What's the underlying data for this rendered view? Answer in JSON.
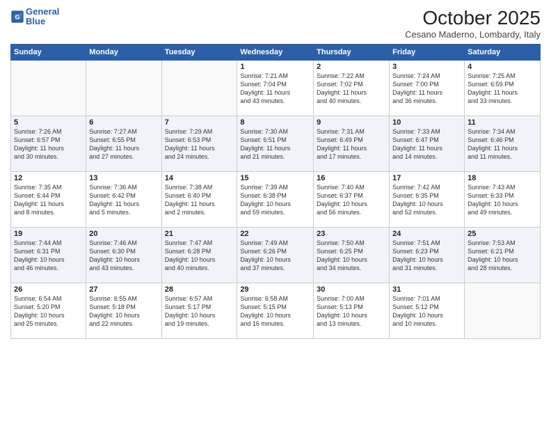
{
  "header": {
    "logo_line1": "General",
    "logo_line2": "Blue",
    "title": "October 2025",
    "location": "Cesano Maderno, Lombardy, Italy"
  },
  "weekdays": [
    "Sunday",
    "Monday",
    "Tuesday",
    "Wednesday",
    "Thursday",
    "Friday",
    "Saturday"
  ],
  "weeks": [
    [
      {
        "day": "",
        "info": ""
      },
      {
        "day": "",
        "info": ""
      },
      {
        "day": "",
        "info": ""
      },
      {
        "day": "1",
        "info": "Sunrise: 7:21 AM\nSunset: 7:04 PM\nDaylight: 11 hours\nand 43 minutes."
      },
      {
        "day": "2",
        "info": "Sunrise: 7:22 AM\nSunset: 7:02 PM\nDaylight: 11 hours\nand 40 minutes."
      },
      {
        "day": "3",
        "info": "Sunrise: 7:24 AM\nSunset: 7:00 PM\nDaylight: 11 hours\nand 36 minutes."
      },
      {
        "day": "4",
        "info": "Sunrise: 7:25 AM\nSunset: 6:59 PM\nDaylight: 11 hours\nand 33 minutes."
      }
    ],
    [
      {
        "day": "5",
        "info": "Sunrise: 7:26 AM\nSunset: 6:57 PM\nDaylight: 11 hours\nand 30 minutes."
      },
      {
        "day": "6",
        "info": "Sunrise: 7:27 AM\nSunset: 6:55 PM\nDaylight: 11 hours\nand 27 minutes."
      },
      {
        "day": "7",
        "info": "Sunrise: 7:29 AM\nSunset: 6:53 PM\nDaylight: 11 hours\nand 24 minutes."
      },
      {
        "day": "8",
        "info": "Sunrise: 7:30 AM\nSunset: 6:51 PM\nDaylight: 11 hours\nand 21 minutes."
      },
      {
        "day": "9",
        "info": "Sunrise: 7:31 AM\nSunset: 6:49 PM\nDaylight: 11 hours\nand 17 minutes."
      },
      {
        "day": "10",
        "info": "Sunrise: 7:33 AM\nSunset: 6:47 PM\nDaylight: 11 hours\nand 14 minutes."
      },
      {
        "day": "11",
        "info": "Sunrise: 7:34 AM\nSunset: 6:46 PM\nDaylight: 11 hours\nand 11 minutes."
      }
    ],
    [
      {
        "day": "12",
        "info": "Sunrise: 7:35 AM\nSunset: 6:44 PM\nDaylight: 11 hours\nand 8 minutes."
      },
      {
        "day": "13",
        "info": "Sunrise: 7:36 AM\nSunset: 6:42 PM\nDaylight: 11 hours\nand 5 minutes."
      },
      {
        "day": "14",
        "info": "Sunrise: 7:38 AM\nSunset: 6:40 PM\nDaylight: 11 hours\nand 2 minutes."
      },
      {
        "day": "15",
        "info": "Sunrise: 7:39 AM\nSunset: 6:38 PM\nDaylight: 10 hours\nand 59 minutes."
      },
      {
        "day": "16",
        "info": "Sunrise: 7:40 AM\nSunset: 6:37 PM\nDaylight: 10 hours\nand 56 minutes."
      },
      {
        "day": "17",
        "info": "Sunrise: 7:42 AM\nSunset: 6:35 PM\nDaylight: 10 hours\nand 52 minutes."
      },
      {
        "day": "18",
        "info": "Sunrise: 7:43 AM\nSunset: 6:33 PM\nDaylight: 10 hours\nand 49 minutes."
      }
    ],
    [
      {
        "day": "19",
        "info": "Sunrise: 7:44 AM\nSunset: 6:31 PM\nDaylight: 10 hours\nand 46 minutes."
      },
      {
        "day": "20",
        "info": "Sunrise: 7:46 AM\nSunset: 6:30 PM\nDaylight: 10 hours\nand 43 minutes."
      },
      {
        "day": "21",
        "info": "Sunrise: 7:47 AM\nSunset: 6:28 PM\nDaylight: 10 hours\nand 40 minutes."
      },
      {
        "day": "22",
        "info": "Sunrise: 7:49 AM\nSunset: 6:26 PM\nDaylight: 10 hours\nand 37 minutes."
      },
      {
        "day": "23",
        "info": "Sunrise: 7:50 AM\nSunset: 6:25 PM\nDaylight: 10 hours\nand 34 minutes."
      },
      {
        "day": "24",
        "info": "Sunrise: 7:51 AM\nSunset: 6:23 PM\nDaylight: 10 hours\nand 31 minutes."
      },
      {
        "day": "25",
        "info": "Sunrise: 7:53 AM\nSunset: 6:21 PM\nDaylight: 10 hours\nand 28 minutes."
      }
    ],
    [
      {
        "day": "26",
        "info": "Sunrise: 6:54 AM\nSunset: 5:20 PM\nDaylight: 10 hours\nand 25 minutes."
      },
      {
        "day": "27",
        "info": "Sunrise: 6:55 AM\nSunset: 5:18 PM\nDaylight: 10 hours\nand 22 minutes."
      },
      {
        "day": "28",
        "info": "Sunrise: 6:57 AM\nSunset: 5:17 PM\nDaylight: 10 hours\nand 19 minutes."
      },
      {
        "day": "29",
        "info": "Sunrise: 6:58 AM\nSunset: 5:15 PM\nDaylight: 10 hours\nand 16 minutes."
      },
      {
        "day": "30",
        "info": "Sunrise: 7:00 AM\nSunset: 5:13 PM\nDaylight: 10 hours\nand 13 minutes."
      },
      {
        "day": "31",
        "info": "Sunrise: 7:01 AM\nSunset: 5:12 PM\nDaylight: 10 hours\nand 10 minutes."
      },
      {
        "day": "",
        "info": ""
      }
    ]
  ]
}
